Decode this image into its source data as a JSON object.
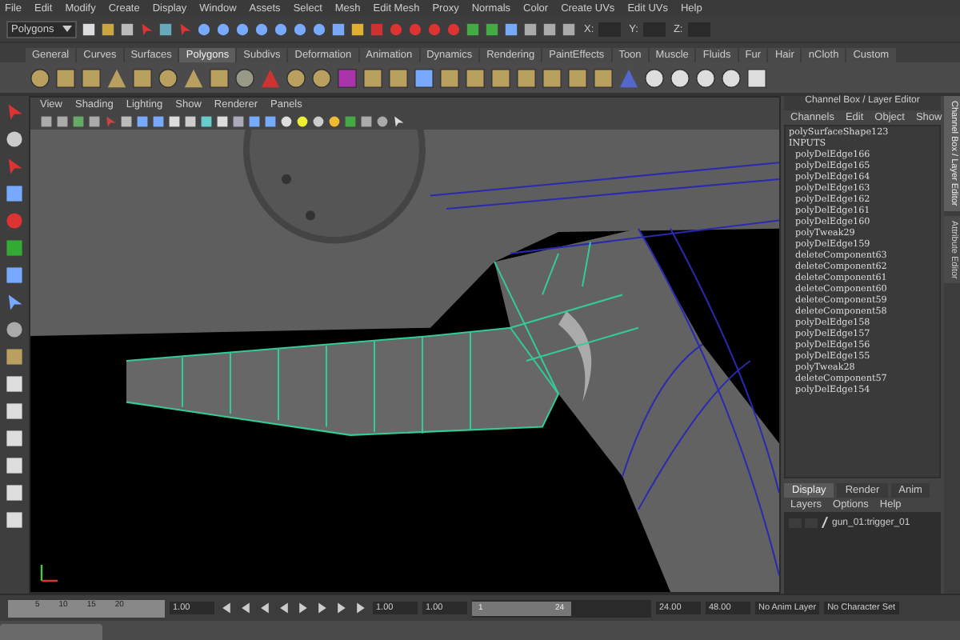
{
  "menu_bar": {
    "items": [
      "File",
      "Edit",
      "Modify",
      "Create",
      "Display",
      "Window",
      "Assets",
      "Select",
      "Mesh",
      "Edit Mesh",
      "Proxy",
      "Normals",
      "Color",
      "Create UVs",
      "Edit UVs",
      "Help"
    ]
  },
  "toolbar": {
    "mode_dropdown": "Polygons",
    "coord_labels": [
      "X:",
      "Y:",
      "Z:"
    ]
  },
  "shelf": {
    "tabs": [
      {
        "label": "General",
        "selected": false
      },
      {
        "label": "Curves",
        "selected": false
      },
      {
        "label": "Surfaces",
        "selected": false
      },
      {
        "label": "Polygons",
        "selected": true
      },
      {
        "label": "Subdivs",
        "selected": false
      },
      {
        "label": "Deformation",
        "selected": false
      },
      {
        "label": "Animation",
        "selected": false
      },
      {
        "label": "Dynamics",
        "selected": false
      },
      {
        "label": "Rendering",
        "selected": false
      },
      {
        "label": "PaintEffects",
        "selected": false
      },
      {
        "label": "Toon",
        "selected": false
      },
      {
        "label": "Muscle",
        "selected": false
      },
      {
        "label": "Fluids",
        "selected": false
      },
      {
        "label": "Fur",
        "selected": false
      },
      {
        "label": "Hair",
        "selected": false
      },
      {
        "label": "nCloth",
        "selected": false
      },
      {
        "label": "Custom",
        "selected": false
      }
    ]
  },
  "viewport": {
    "menu": [
      "View",
      "Shading",
      "Lighting",
      "Show",
      "Renderer",
      "Panels"
    ]
  },
  "channel_box": {
    "title": "Channel Box / Layer Editor",
    "menu": [
      "Channels",
      "Edit",
      "Object",
      "Show"
    ],
    "shape": "polySurfaceShape123",
    "inputs_label": "INPUTS",
    "inputs": [
      "polyDelEdge166",
      "polyDelEdge165",
      "polyDelEdge164",
      "polyDelEdge163",
      "polyDelEdge162",
      "polyDelEdge161",
      "polyDelEdge160",
      "polyTweak29",
      "polyDelEdge159",
      "deleteComponent63",
      "deleteComponent62",
      "deleteComponent61",
      "deleteComponent60",
      "deleteComponent59",
      "deleteComponent58",
      "polyDelEdge158",
      "polyDelEdge157",
      "polyDelEdge156",
      "polyDelEdge155",
      "polyTweak28",
      "deleteComponent57",
      "polyDelEdge154"
    ]
  },
  "side_tabs": [
    {
      "label": "Channel Box / Layer Editor",
      "selected": true
    },
    {
      "label": "Attribute Editor",
      "selected": false
    }
  ],
  "layer_editor": {
    "tabs": [
      {
        "label": "Display",
        "selected": true
      },
      {
        "label": "Render",
        "selected": false
      },
      {
        "label": "Anim",
        "selected": false
      }
    ],
    "menu": [
      "Layers",
      "Options",
      "Help"
    ],
    "layers": [
      {
        "name": "gun_01:trigger_01"
      }
    ]
  },
  "time_slider": {
    "ticks": [
      "5",
      "10",
      "15",
      "20"
    ],
    "current_time": "1.00",
    "start_time": "1.00",
    "playback_start": "1.00",
    "range": {
      "start": "1",
      "end": "24",
      "level": 0.55
    },
    "playback_end": "24.00",
    "end_time": "48.00",
    "anim_layer": "No Anim Layer",
    "character_set": "No Character Set"
  }
}
